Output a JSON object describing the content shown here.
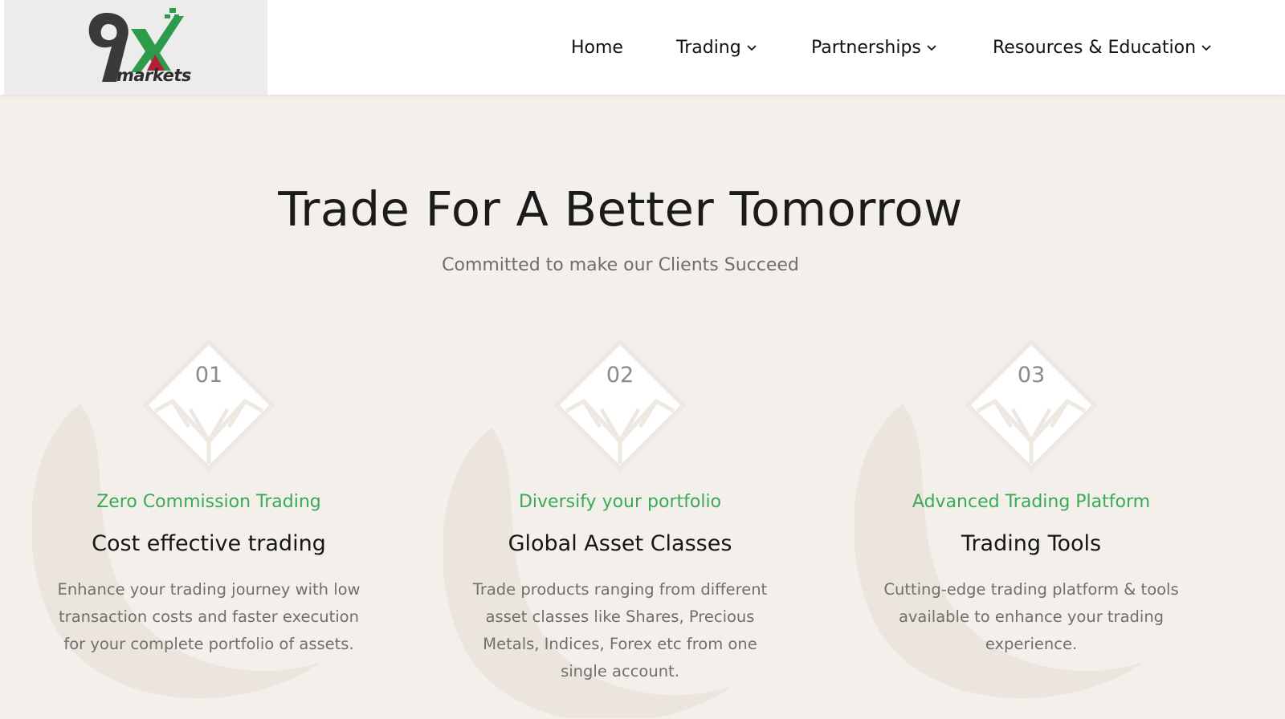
{
  "brand": {
    "name": "markets",
    "accent_green": "#2e9b4a",
    "accent_red": "#b0203a",
    "dark": "#3a3a3a"
  },
  "nav": {
    "items": [
      {
        "label": "Home",
        "has_dropdown": false
      },
      {
        "label": "Trading",
        "has_dropdown": true
      },
      {
        "label": "Partnerships",
        "has_dropdown": true
      },
      {
        "label": "Resources & Education",
        "has_dropdown": true
      }
    ]
  },
  "hero": {
    "title": "Trade For A Better Tomorrow",
    "subtitle": "Committed to make our Clients Succeed"
  },
  "features": [
    {
      "number": "01",
      "kicker": "Zero Commission Trading",
      "title": "Cost effective trading",
      "description": "Enhance your trading journey with low transaction costs and faster execution for your complete portfolio of assets."
    },
    {
      "number": "02",
      "kicker": "Diversify your portfolio",
      "title": "Global Asset Classes",
      "description": "Trade products ranging from different asset classes like Shares, Precious Metals, Indices, Forex etc from one single account."
    },
    {
      "number": "03",
      "kicker": "Advanced Trading Platform",
      "title": "Trading Tools",
      "description": "Cutting-edge trading platform & tools available to enhance your trading experience."
    }
  ],
  "colors": {
    "page_bg": "#f3efea",
    "kicker_green": "#3aaa55"
  }
}
